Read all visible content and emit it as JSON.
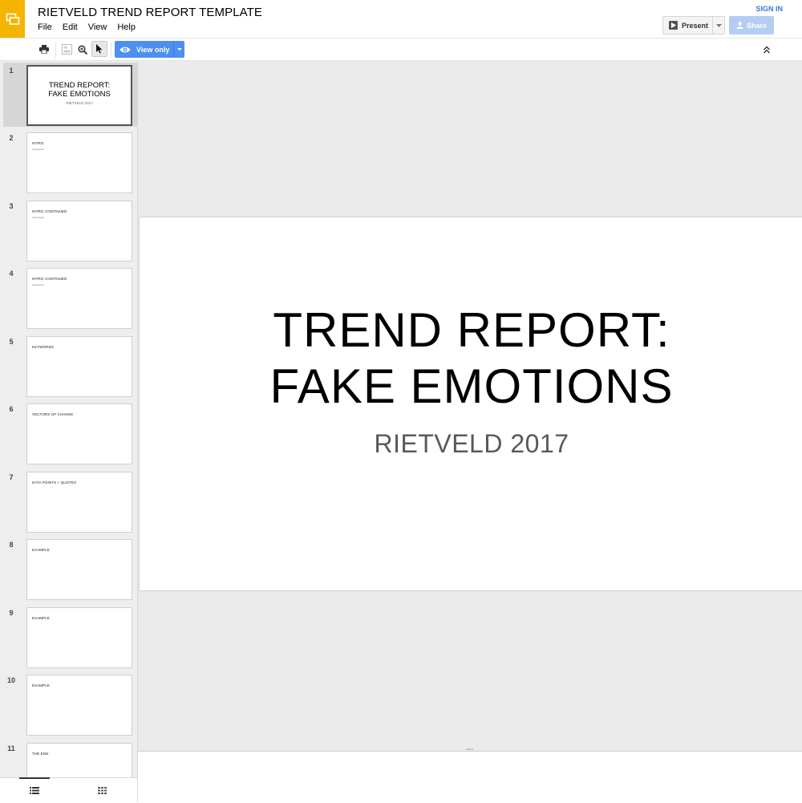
{
  "header": {
    "title": "RIETVELD TREND REPORT TEMPLATE",
    "menus": [
      "File",
      "Edit",
      "View",
      "Help"
    ],
    "sign_in": "SIGN IN",
    "present": "Present",
    "share": "Share"
  },
  "toolbar": {
    "view_only": "View only"
  },
  "main_slide": {
    "title_line1": "TREND REPORT:",
    "title_line2": "FAKE EMOTIONS",
    "subtitle": "RIETVELD 2017"
  },
  "slides": [
    {
      "num": "1",
      "title_line1": "TREND REPORT:",
      "title_line2": "FAKE EMOTIONS",
      "subtitle": "RIETVELD 2017"
    },
    {
      "num": "2",
      "title": "INTRO",
      "body": "Lorem ipsum"
    },
    {
      "num": "3",
      "title": "INTRO CONTINUED",
      "body": "Lorem ipsum"
    },
    {
      "num": "4",
      "title": "INTRO CONTINUED",
      "body": "Lorem ipsum"
    },
    {
      "num": "5",
      "title": "KEYWORDS"
    },
    {
      "num": "6",
      "title": "VECTORS OF CHANGE"
    },
    {
      "num": "7",
      "title": "DATA POINTS + QUOTES"
    },
    {
      "num": "8",
      "title": "EXAMPLE"
    },
    {
      "num": "9",
      "title": "EXAMPLE"
    },
    {
      "num": "10",
      "title": "EXAMPLE"
    },
    {
      "num": "11",
      "title": "THE END"
    }
  ],
  "colors": {
    "brand": "#f5b400",
    "accent": "#4d8fef",
    "link": "#3c78d8"
  }
}
